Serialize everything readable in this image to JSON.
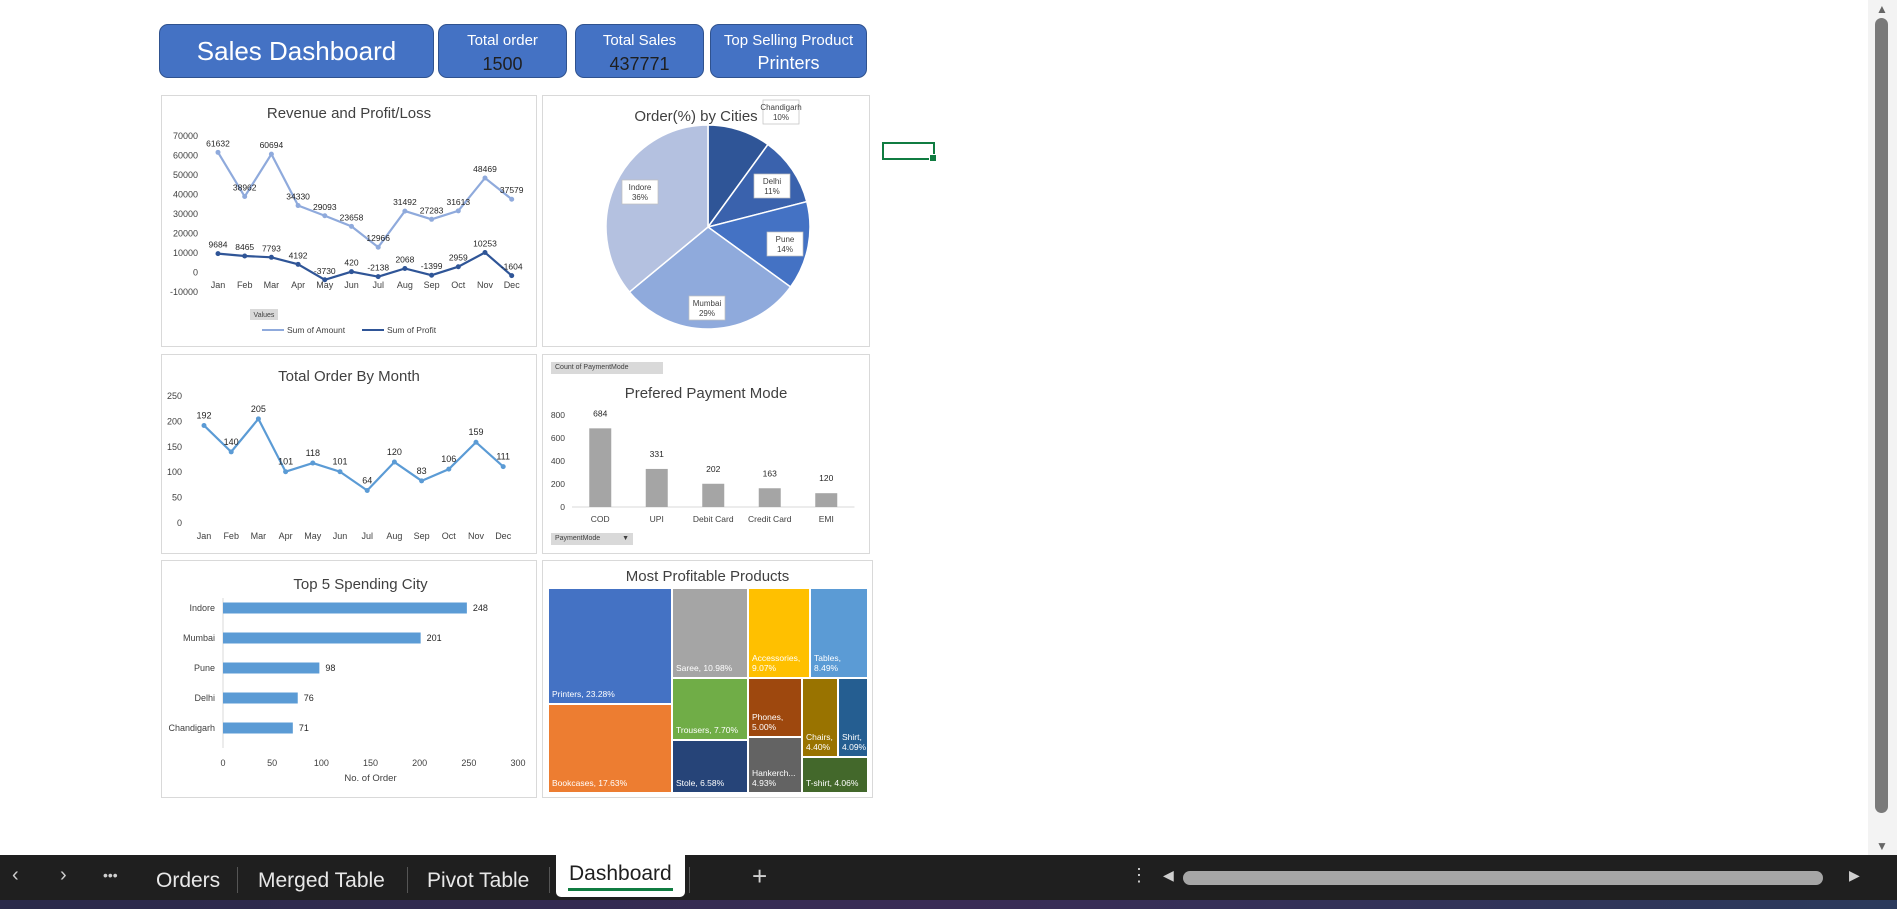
{
  "kpis": {
    "title": "Sales Dashboard",
    "total_order_label": "Total order",
    "total_order_value": "1500",
    "total_sales_label": "Total Sales",
    "total_sales_value": "437771",
    "top_product_label": "Top Selling Product",
    "top_product_value": "Printers",
    "accent": "#4472c4"
  },
  "rev_chart": {
    "title": "Revenue and Profit/Loss",
    "months": [
      "Jan",
      "Feb",
      "Mar",
      "Apr",
      "May",
      "Jun",
      "Jul",
      "Aug",
      "Sep",
      "Oct",
      "Nov",
      "Dec"
    ],
    "yticks": [
      "70000",
      "60000",
      "50000",
      "40000",
      "30000",
      "20000",
      "10000",
      "0",
      "-10000"
    ],
    "amount": [
      61632,
      38962,
      60694,
      34330,
      29093,
      23658,
      12966,
      31492,
      27283,
      31613,
      48469,
      37579
    ],
    "amount_labels": [
      "61632",
      "38962",
      "60694",
      "34330",
      "29093",
      "23658",
      "12966",
      "31492",
      "27283",
      "31613",
      "48469",
      "37579"
    ],
    "profit": [
      9684,
      8465,
      7793,
      4192,
      -3730,
      420,
      -2138,
      2068,
      -1399,
      2959,
      10253,
      -1604
    ],
    "profit_labels": [
      "9684",
      "8465",
      "7793",
      "4192",
      "-3730",
      "420",
      "-2138",
      "2068",
      "-1399",
      "2959",
      "10253",
      "-1604"
    ],
    "values_button": "Values",
    "legend_amount": "Sum of Amount",
    "legend_profit": "Sum of Profit",
    "color_amount": "#8faadc",
    "color_profit": "#2f5597"
  },
  "pie_chart": {
    "title": "Order(%) by Cities",
    "slices": [
      {
        "name": "Chandigarh",
        "pct_label": "10%",
        "value": 10,
        "color": "#2f5597"
      },
      {
        "name": "Delhi",
        "pct_label": "11%",
        "value": 11,
        "color": "#3a62ad"
      },
      {
        "name": "Pune",
        "pct_label": "14%",
        "value": 14,
        "color": "#4472c4"
      },
      {
        "name": "Mumbai",
        "pct_label": "29%",
        "value": 29,
        "color": "#8faadc"
      },
      {
        "name": "Indore",
        "pct_label": "36%",
        "value": 36,
        "color": "#b4c1e0"
      }
    ]
  },
  "order_chart": {
    "title": "Total Order By Month",
    "months": [
      "Jan",
      "Feb",
      "Mar",
      "Apr",
      "May",
      "Jun",
      "Jul",
      "Aug",
      "Sep",
      "Oct",
      "Nov",
      "Dec"
    ],
    "yticks": [
      "250",
      "200",
      "150",
      "100",
      "50",
      "0"
    ],
    "values": [
      192,
      140,
      205,
      101,
      118,
      101,
      64,
      120,
      83,
      106,
      159,
      111
    ],
    "value_labels": [
      "192",
      "140",
      "205",
      "101",
      "118",
      "101",
      "64",
      "120",
      "83",
      "106",
      "159",
      "111"
    ],
    "color": "#5b9bd5"
  },
  "pay_chart": {
    "field_button": "Count of PaymentMode",
    "title": "Prefered Payment Mode",
    "categories": [
      "COD",
      "UPI",
      "Debit Card",
      "Credit Card",
      "EMI"
    ],
    "values": [
      684,
      331,
      202,
      163,
      120
    ],
    "value_labels": [
      "684",
      "331",
      "202",
      "163",
      "120"
    ],
    "yticks": [
      "800",
      "600",
      "400",
      "200",
      "0"
    ],
    "filter_button": "PaymentMode",
    "color": "#a5a5a5"
  },
  "city_chart": {
    "title": "Top 5 Spending City",
    "categories": [
      "Indore",
      "Mumbai",
      "Pune",
      "Delhi",
      "Chandigarh"
    ],
    "values": [
      248,
      201,
      98,
      76,
      71
    ],
    "value_labels": [
      "248",
      "201",
      "98",
      "76",
      "71"
    ],
    "xticks": [
      "0",
      "50",
      "100",
      "150",
      "200",
      "250",
      "300"
    ],
    "xlabel": "No. of Order",
    "color": "#5b9bd5"
  },
  "tree_chart": {
    "title": "Most Profitable Products",
    "tiles": [
      {
        "label": "Printers, 23.28%",
        "color": "#4472c4"
      },
      {
        "label": "Bookcases, 17.63%",
        "color": "#ed7d31"
      },
      {
        "label": "Saree, 10.98%",
        "color": "#a5a5a5"
      },
      {
        "label": "Accessories, 9.07%",
        "color": "#ffc000"
      },
      {
        "label": "Tables, 8.49%",
        "color": "#5b9bd5"
      },
      {
        "label": "Trousers, 7.70%",
        "color": "#70ad47"
      },
      {
        "label": "Stole, 6.58%",
        "color": "#264478"
      },
      {
        "label": "Phones, 5.00%",
        "color": "#9e480e"
      },
      {
        "label": "Hankerch... 4.93%",
        "color": "#636363"
      },
      {
        "label": "Chairs, 4.40%",
        "color": "#997300"
      },
      {
        "label": "Shirt, 4.09%",
        "color": "#255e91"
      },
      {
        "label": "T-shirt, 4.06%",
        "color": "#43682b"
      }
    ]
  },
  "tabs": {
    "orders": "Orders",
    "merged": "Merged Table",
    "pivot": "Pivot Table",
    "dashboard": "Dashboard",
    "add": "+",
    "more": "•••"
  }
}
